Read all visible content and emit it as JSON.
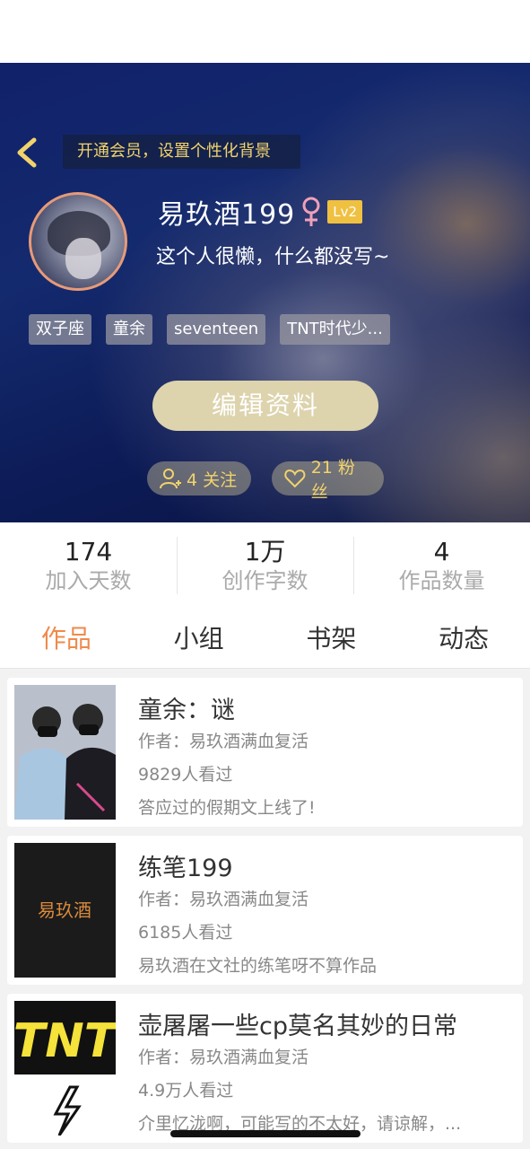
{
  "header": {
    "vip_banner": "开通会员，设置个性化背景"
  },
  "profile": {
    "username": "易玖酒199",
    "gender": "female",
    "level": "Lv2",
    "bio": "这个人很懒，什么都没写~",
    "tags": [
      "双子座",
      "童余",
      "seventeen",
      "TNT时代少..."
    ],
    "edit_label": "编辑资料",
    "following": "4 关注",
    "fans": "21 粉丝"
  },
  "stats": [
    {
      "value": "174",
      "label": "加入天数"
    },
    {
      "value": "1万",
      "label": "创作字数"
    },
    {
      "value": "4",
      "label": "作品数量"
    }
  ],
  "tabs": [
    {
      "label": "作品",
      "active": true
    },
    {
      "label": "小组",
      "active": false
    },
    {
      "label": "书架",
      "active": false
    },
    {
      "label": "动态",
      "active": false
    }
  ],
  "works": [
    {
      "title": "童余：谜",
      "author": "作者：易玖酒满血复活",
      "views": "9829人看过",
      "desc": "答应过的假期文上线了!"
    },
    {
      "title": "练笔199",
      "author": "作者：易玖酒满血复活",
      "views": "6185人看过",
      "desc": "易玖酒在文社的练笔呀不算作品",
      "cover_text": "易玖酒"
    },
    {
      "title": "壶屠屠一些cp莫名其妙的日常",
      "author": "作者：易玖酒满血复活",
      "views": "4.9万人看过",
      "desc": "介里忆泷啊，可能写的不太好，请谅解，...",
      "cover_text": "TNT"
    }
  ],
  "colors": {
    "accent": "#ef8a4c",
    "gold": "#f2d36b",
    "level_badge": "#f0c040",
    "avatar_ring": "#e79a78"
  }
}
